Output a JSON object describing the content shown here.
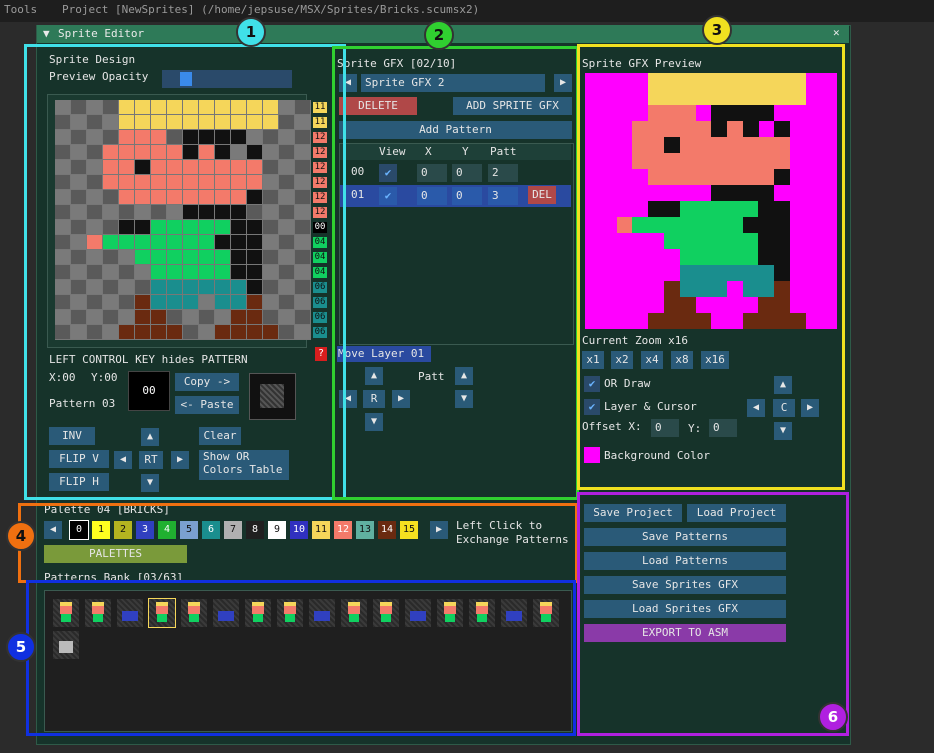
{
  "menubar": {
    "tools": "Tools",
    "project": "Project [NewSprites] (/home/jepsuse/MSX/Sprites/Bricks.scumsx2)"
  },
  "window": {
    "title": "Sprite Editor",
    "collapse_glyph": "▼",
    "close_glyph": "✕"
  },
  "badges": [
    "1",
    "2",
    "3",
    "4",
    "5",
    "6"
  ],
  "design": {
    "heading": "Sprite Design",
    "opacity_label": "Preview Opacity",
    "hint": "LEFT CONTROL KEY hides PATTERN",
    "x_label": "X:00",
    "y_label": "Y:00",
    "pattern_value": "00",
    "pattern_label": "Pattern 03",
    "copy": "Copy ->",
    "paste": "<- Paste",
    "inv": "INV",
    "flip_v": "FLIP V",
    "flip_h": "FLIP H",
    "rt": "RT",
    "clear": "Clear",
    "show_or": "Show OR\nColors Table",
    "question": "?",
    "row_colors": [
      "11",
      "11",
      "12",
      "12",
      "12",
      "12",
      "12",
      "12",
      "00",
      "04",
      "04",
      "04",
      "06",
      "06",
      "06",
      "06"
    ]
  },
  "gfx": {
    "heading": "Sprite GFX [02/10]",
    "current": "Sprite GFX 2",
    "delete": "DELETE",
    "add_gfx": "ADD SPRITE GFX",
    "add_pattern": "Add Pattern",
    "columns": [
      "View",
      "X",
      "Y",
      "Patt"
    ],
    "rows": [
      {
        "id": "00",
        "x": "0",
        "y": "0",
        "patt": "2"
      },
      {
        "id": "01",
        "x": "0",
        "y": "0",
        "patt": "3",
        "del": "DEL"
      }
    ],
    "move_layer": "Move Layer 01",
    "r": "R",
    "patt": "Patt"
  },
  "preview": {
    "heading": "Sprite GFX Preview",
    "zoom_label": "Current Zoom x16",
    "zooms": [
      "x1",
      "x2",
      "x4",
      "x8",
      "x16"
    ],
    "or_draw": "OR Draw",
    "layer_cursor": "Layer & Cursor",
    "c": "C",
    "offset_x_label": "Offset X:",
    "offset_x": "0",
    "offset_y_label": "Y:",
    "offset_y": "0",
    "bg_label": "Background Color"
  },
  "palette": {
    "heading": "Palette 04 [BRICKS]",
    "hint": "Left Click to\nExchange Patterns",
    "button": "PALETTES",
    "colors": [
      "0",
      "1",
      "2",
      "3",
      "4",
      "5",
      "6",
      "7",
      "8",
      "9",
      "10",
      "11",
      "12",
      "13",
      "14",
      "15"
    ]
  },
  "bank": {
    "heading": "Patterns Bank [03/63]"
  },
  "actions": {
    "save_project": "Save Project",
    "load_project": "Load Project",
    "save_patterns": "Save Patterns",
    "load_patterns": "Load Patterns",
    "save_sprites": "Save Sprites GFX",
    "load_sprites": "Load Sprites GFX",
    "export": "EXPORT TO ASM"
  },
  "colors": {
    "magenta": "#ff00ff",
    "yellow": "#f5d65a",
    "salmon": "#f37a6a",
    "black": "#111111",
    "green": "#10d060",
    "teal": "#1a8e8e",
    "brown": "#6a2a10"
  }
}
